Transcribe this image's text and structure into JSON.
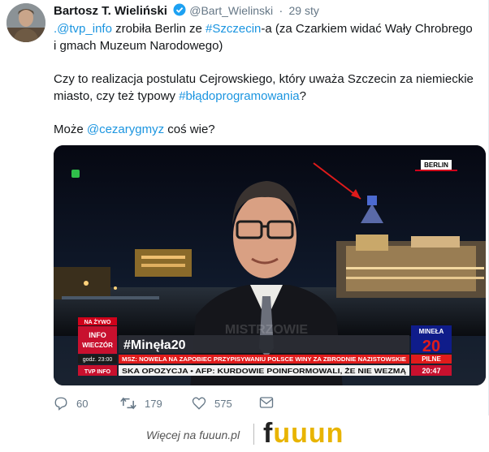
{
  "tweet": {
    "author_name": "Bartosz T. Wieliński",
    "handle": "@Bart_Wielinski",
    "separator": "·",
    "time": "29 sty",
    "text": {
      "p1_link1": ".@tvp_info",
      "p1_t1": " zrobiła Berlin ze ",
      "p1_link2": "#Szczecin",
      "p1_t2": "-a (za Czarkiem widać Wały Chrobrego i gmach Muzeum Narodowego)",
      "p2_t1": "Czy to realizacja postulatu Cejrowskiego, który uważa Szczecin za niemieckie miasto, czy też typowy ",
      "p2_link": "#błądoprogramowania",
      "p2_t2": "?",
      "p3_t1": "Może ",
      "p3_link": "@cezarygmyz",
      "p3_t2": " coś wie?"
    },
    "media": {
      "location_label": "BERLIN",
      "live_label": "NA ŻYWO",
      "program_line1": "INFO",
      "program_line2": "WIECZÓR",
      "hashtag": "#Minęła20",
      "clock_prefix": "godz.",
      "clock": "23:00",
      "ticker1": "MSZ: NOWELA NA ZAPOBIEC PRZYPISYWANIU POLSCE WINY ZA ZBRODNIE NAZISTOWSKIE",
      "ticker1_tag": "PILNE",
      "ticker2_logo": "TVP INFO",
      "ticker2": "SKA OPOZYCJA • AFP: KURDOWIE POINFORMOWALI, ŻE NIE WEZMĄ",
      "ticker2_time": "20:47",
      "brand_small": "MINEŁA",
      "brand_big": "20",
      "watermark": "MISTRZOWIE"
    },
    "actions": {
      "replies": "60",
      "retweets": "179",
      "likes": "575"
    }
  },
  "footer": {
    "text": "Więcej na fuuun.pl",
    "logo_part1": "f",
    "logo_part2": "uuun"
  },
  "colors": {
    "link": "#1b95e0",
    "tvp_red": "#d0021b",
    "logo_yellow": "#e8b400"
  }
}
